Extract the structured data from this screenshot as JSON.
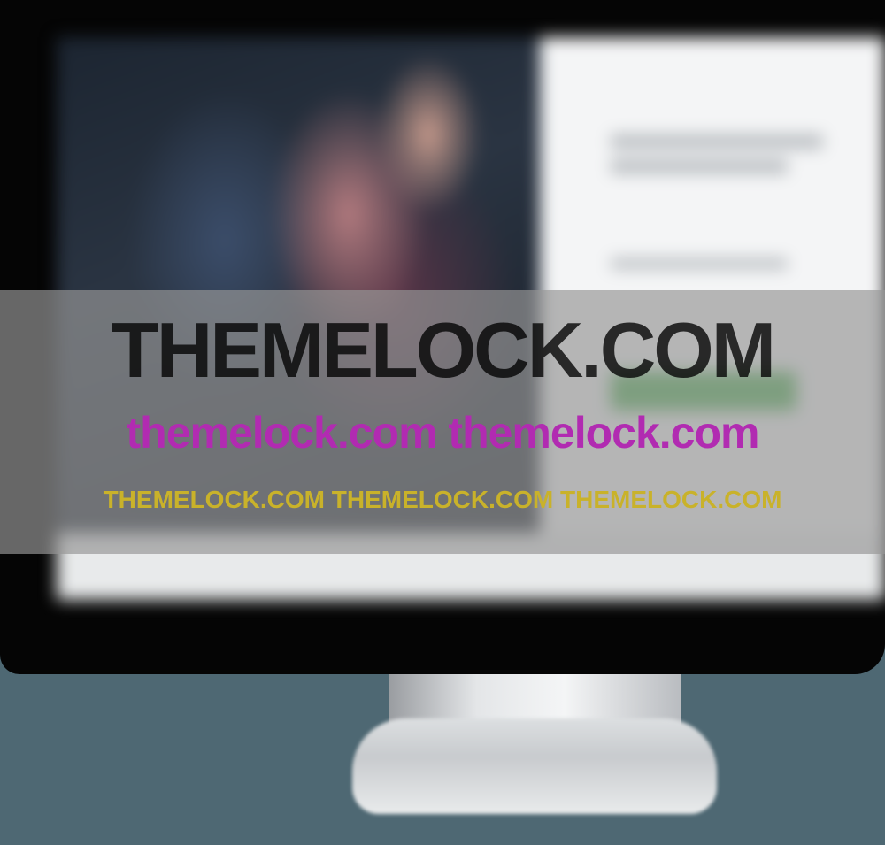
{
  "watermark": {
    "line_1": "THEMELOCK.COM",
    "line_2": "themelock.com themelock.com",
    "line_3": "THEMELOCK.COM THEMELOCK.COM THEMELOCK.COM"
  },
  "colors": {
    "background": "#4e6873",
    "bezel": "#050505",
    "watermark_band": "#969696",
    "watermark_line_1": "#000000",
    "watermark_line_2": "#b12bb1",
    "watermark_line_3": "#c9b22a",
    "cta_button": "#4caf50"
  },
  "icons": {
    "monitor": "monitor-icon"
  }
}
